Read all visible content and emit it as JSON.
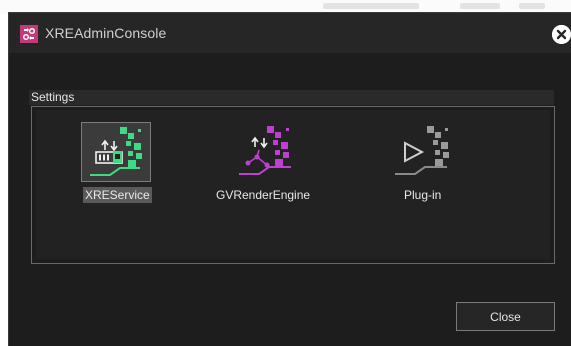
{
  "window": {
    "title": "XREAdminConsole"
  },
  "settings": {
    "group_label": "Settings",
    "items": [
      {
        "label": "XREService",
        "icon": "xre-service-icon",
        "selected": true,
        "accent": "#3ddc84"
      },
      {
        "label": "GVRenderEngine",
        "icon": "gv-render-engine-icon",
        "selected": false,
        "accent": "#c03fd3"
      },
      {
        "label": "Plug-in",
        "icon": "plugin-icon",
        "selected": false,
        "accent": "#9a9a9a"
      }
    ]
  },
  "footer": {
    "close_label": "Close"
  },
  "colors": {
    "window_bg": "#1d1d1d",
    "titlebar_bg": "#262626",
    "app_icon": "#c33a7a",
    "selection_bg": "#5a5a5a"
  }
}
